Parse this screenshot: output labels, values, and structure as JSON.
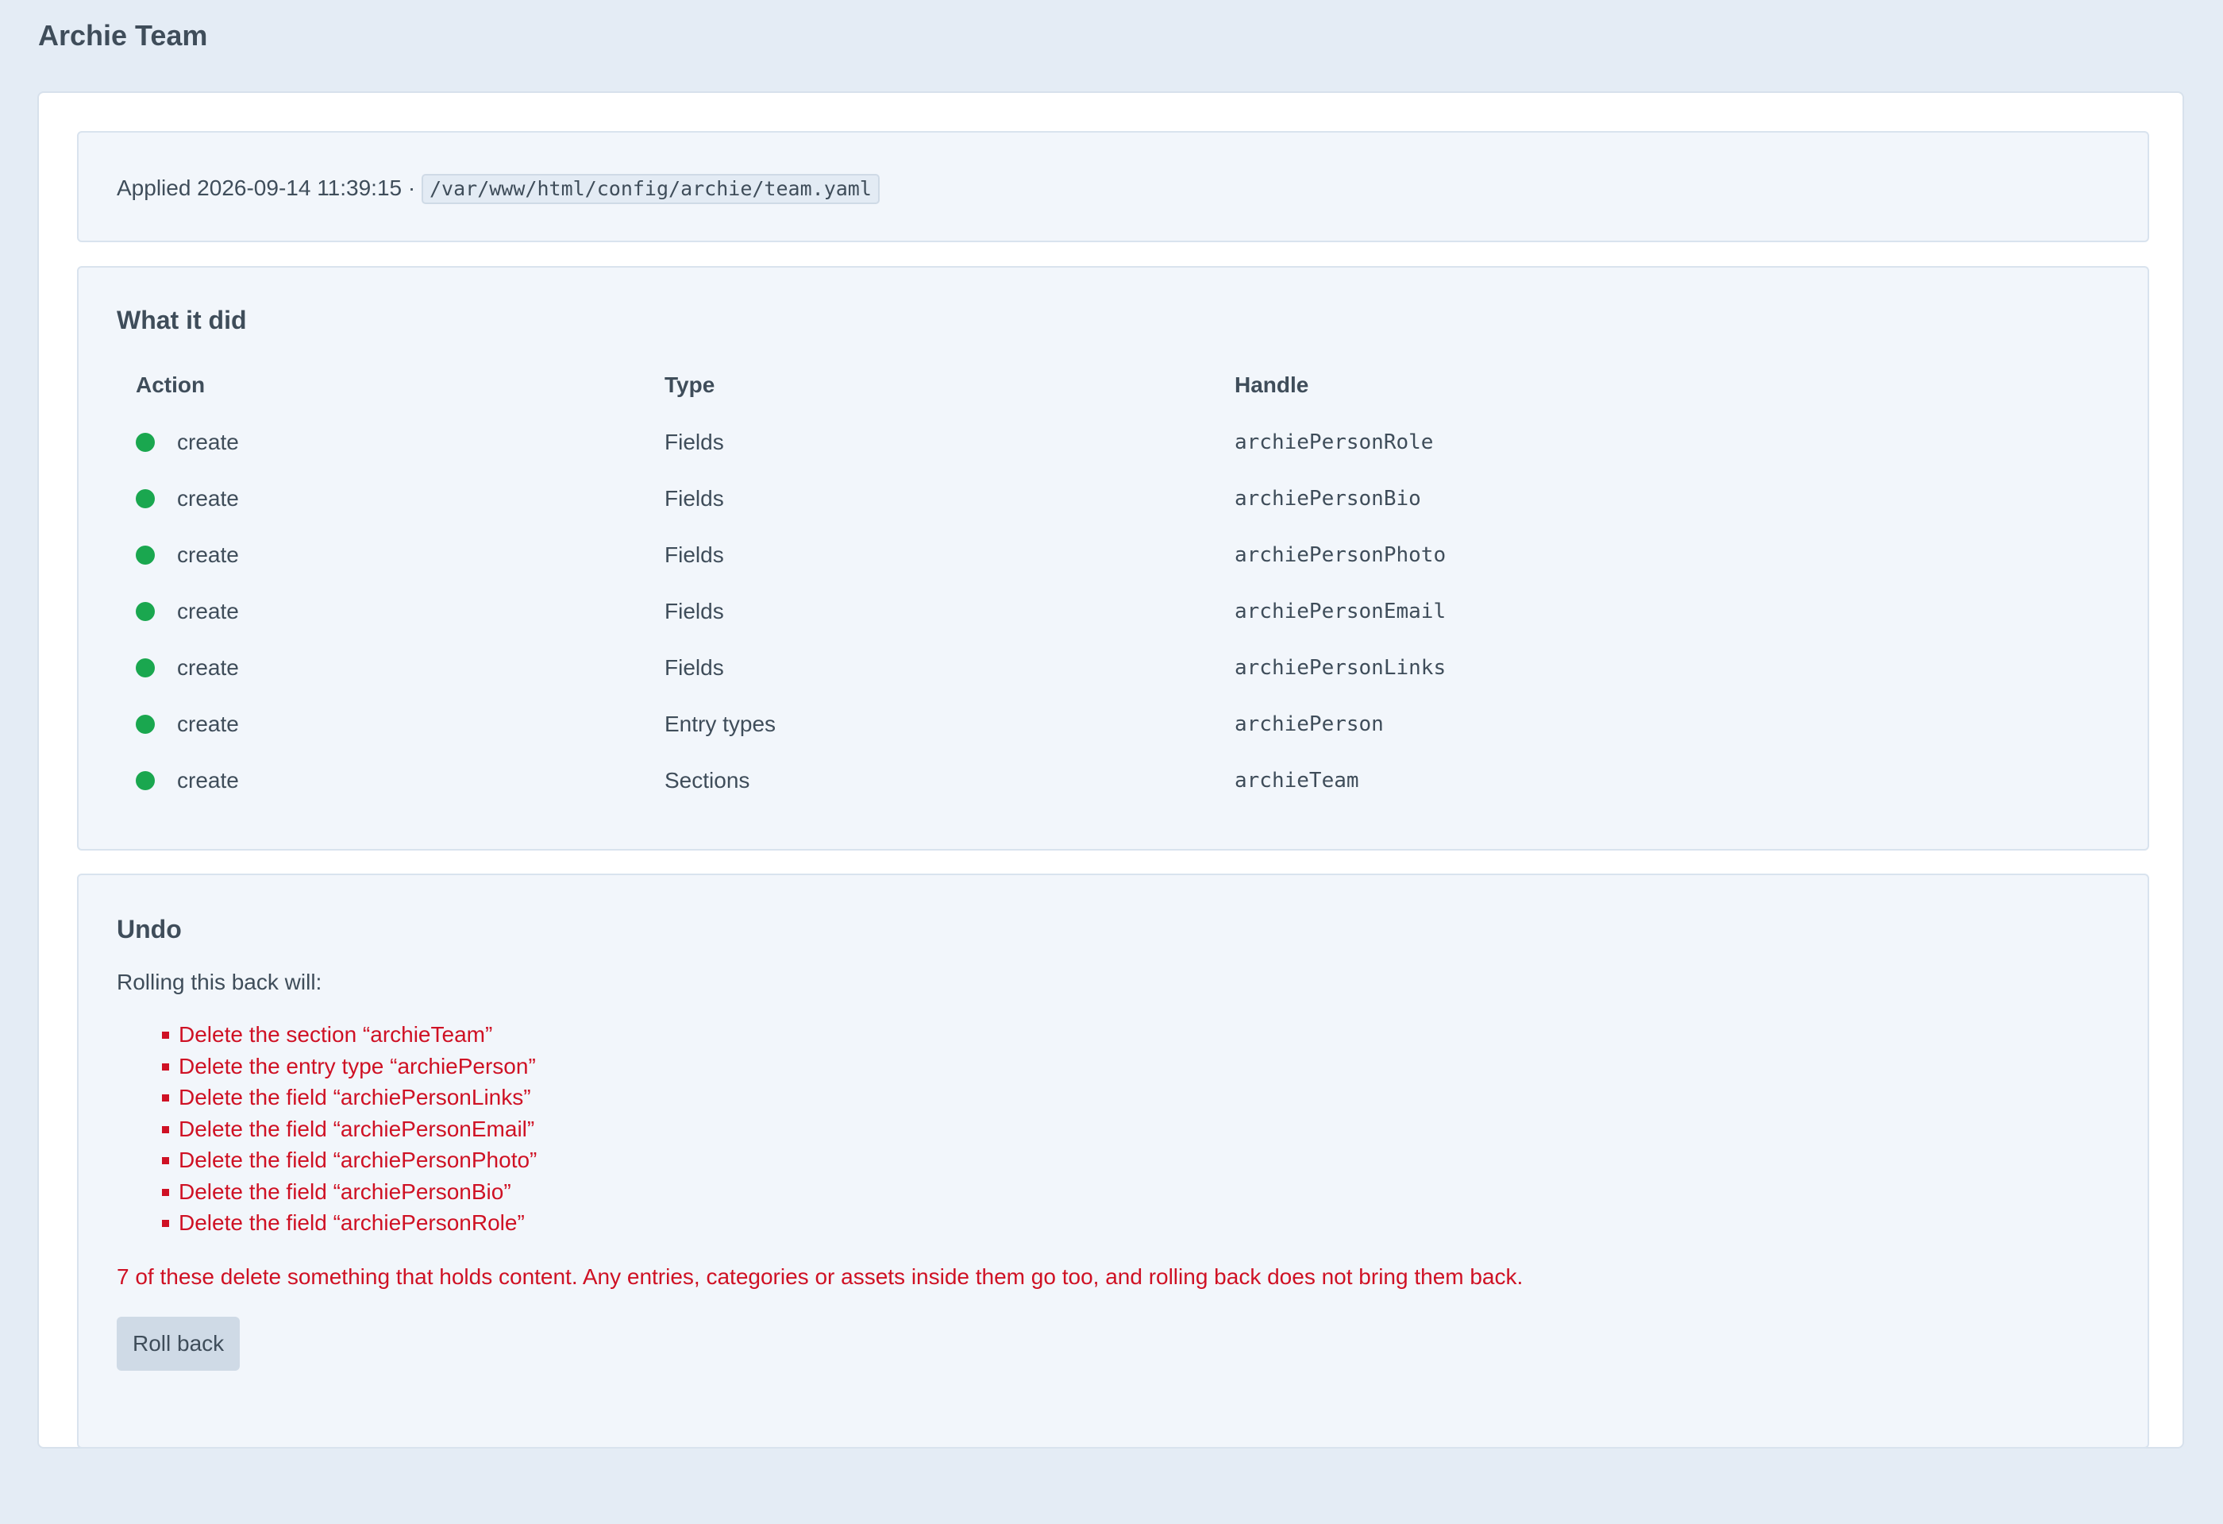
{
  "page": {
    "title": "Archie Team"
  },
  "meta": {
    "applied_text": "Applied 2026-09-14 11:39:15 · ",
    "file_path": "/var/www/html/config/archie/team.yaml"
  },
  "what_it_did": {
    "heading": "What it did",
    "columns": {
      "action": "Action",
      "type": "Type",
      "handle": "Handle"
    },
    "rows": [
      {
        "action": "create",
        "type": "Fields",
        "handle": "archiePersonRole"
      },
      {
        "action": "create",
        "type": "Fields",
        "handle": "archiePersonBio"
      },
      {
        "action": "create",
        "type": "Fields",
        "handle": "archiePersonPhoto"
      },
      {
        "action": "create",
        "type": "Fields",
        "handle": "archiePersonEmail"
      },
      {
        "action": "create",
        "type": "Fields",
        "handle": "archiePersonLinks"
      },
      {
        "action": "create",
        "type": "Entry types",
        "handle": "archiePerson"
      },
      {
        "action": "create",
        "type": "Sections",
        "handle": "archieTeam"
      }
    ],
    "status_color": "#1aa74f"
  },
  "undo": {
    "heading": "Undo",
    "intro": "Rolling this back will:",
    "items": [
      "Delete the section “archieTeam”",
      "Delete the entry type “archiePerson”",
      "Delete the field “archiePersonLinks”",
      "Delete the field “archiePersonEmail”",
      "Delete the field “archiePersonPhoto”",
      "Delete the field “archiePersonBio”",
      "Delete the field “archiePersonRole”"
    ],
    "warning": "7 of these delete something that holds content. Any entries, categories or assets inside them go too, and rolling back does not bring them back.",
    "button_label": "Roll back",
    "danger_color": "#cf1124"
  }
}
